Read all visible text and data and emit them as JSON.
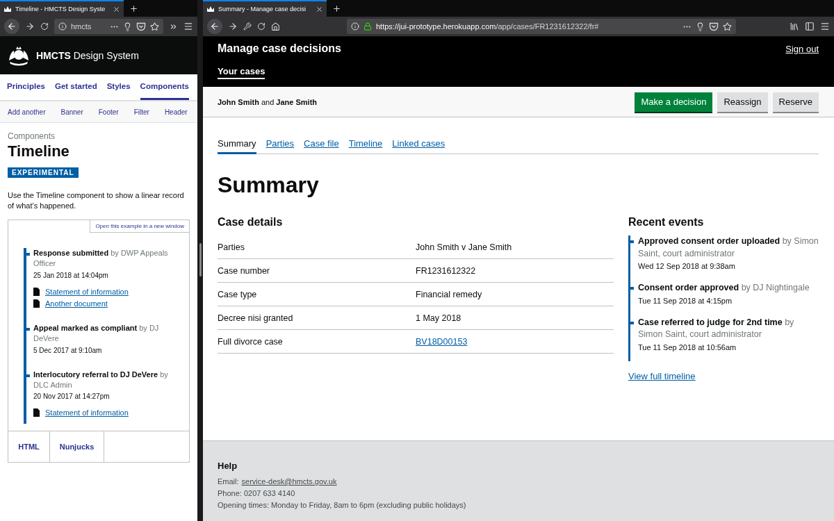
{
  "left_window": {
    "tab_title": "Timeline - HMCTS Design Syste",
    "url": "hmcts",
    "header": {
      "brand_bold": "HMCTS",
      "brand_rest": "Design System"
    },
    "nav": [
      {
        "label": "Principles",
        "selected": false
      },
      {
        "label": "Get started",
        "selected": false
      },
      {
        "label": "Styles",
        "selected": false
      },
      {
        "label": "Components",
        "selected": true
      }
    ],
    "subnav": [
      "Add another",
      "Banner",
      "Footer",
      "Filter",
      "Header"
    ],
    "caption": "Components",
    "title": "Timeline",
    "tag": "EXPERIMENTAL",
    "intro": "Use the Timeline component to show a linear record of what’s happened.",
    "example_link": "Open this example in a new window",
    "timeline": [
      {
        "title": "Response submitted",
        "by": "by DWP Appeals Officer",
        "date": "25 Jan 2018 at 14:04pm",
        "documents": [
          "Statement of information",
          "Another document"
        ]
      },
      {
        "title": "Appeal marked as compliant",
        "by": "by DJ DeVere",
        "date": "5 Dec 2017 at 9:10am"
      },
      {
        "title": "Interlocutory referral to DJ DeVere",
        "by": "by DLC Admin",
        "date": "20 Nov 2017 at 14:27pm",
        "documents": [
          "Statement of information"
        ]
      }
    ],
    "code_tabs": [
      "HTML",
      "Nunjucks"
    ]
  },
  "right_window": {
    "tab_title": "Summary - Manage case decisi",
    "url_host": "https://jui-prototype.herokuapp.com",
    "url_path": "/app/cases/FR1231612322/fr#",
    "header": {
      "service": "Manage case decisions",
      "sign_out": "Sign out",
      "nav": [
        {
          "label": "Your cases",
          "selected": true
        }
      ]
    },
    "parties": "**John Smith** and **Jane Smith**",
    "buttons": [
      {
        "label": "Make a decision",
        "kind": "primary"
      },
      {
        "label": "Reassign",
        "kind": "secondary"
      },
      {
        "label": "Reserve",
        "kind": "secondary"
      }
    ],
    "tabs": [
      {
        "label": "Summary",
        "selected": true
      },
      {
        "label": "Parties",
        "selected": false
      },
      {
        "label": "Case file",
        "selected": false
      },
      {
        "label": "Timeline",
        "selected": false
      },
      {
        "label": "Linked cases",
        "selected": false
      }
    ],
    "heading": "Summary",
    "case_details": {
      "title": "Case details",
      "rows": [
        {
          "label": "Parties",
          "value": "John Smith v Jane Smith",
          "kind": "text"
        },
        {
          "label": "Case number",
          "value": "FR1231612322",
          "kind": "text"
        },
        {
          "label": "Case type",
          "value": "Financial remedy",
          "kind": "text"
        },
        {
          "label": "Decree nisi granted",
          "value": "1 May 2018",
          "kind": "text"
        },
        {
          "label": "Full divorce case",
          "value": "BV18D00153",
          "kind": "link"
        }
      ]
    },
    "recent_events": {
      "title": "Recent events",
      "events": [
        {
          "title": "Approved consent order uploaded",
          "by": "by Simon Saint, court administrator",
          "date": "Wed 12 Sep 2018 at 9:38am"
        },
        {
          "title": "Consent order approved",
          "by": "by DJ Nightingale",
          "date": "Tue 11 Sep 2018 at 4:15pm"
        },
        {
          "title": "Case referred to judge for 2nd time",
          "by": "by Simon Saint, court administrator",
          "date": "Tue 11 Sep 2018 at 10:56am"
        }
      ],
      "link": "View full timeline"
    },
    "footer": {
      "title": "Help",
      "email_label": "Email:",
      "email": "service-desk@hmcts.gov.uk",
      "phone": "Phone: 0207 633 4140",
      "hours": "Opening times: Monday to Friday, 8am to 6pm (excluding public holidays)"
    }
  }
}
